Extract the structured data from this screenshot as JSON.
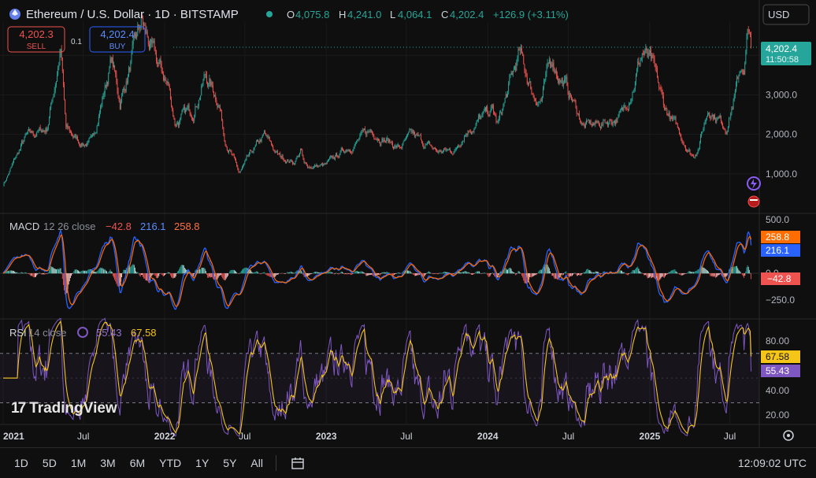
{
  "header": {
    "symbol": "Ethereum / U.S. Dollar · 1D · BITSTAMP",
    "open_label": "O",
    "open": "4,075.8",
    "high_label": "H",
    "high": "4,241.0",
    "low_label": "L",
    "low": "4,064.1",
    "close_label": "C",
    "close": "4,202.4",
    "change": "+126.9 (+3.11%)",
    "currency": "USD"
  },
  "trade": {
    "sell_price": "4,202.3",
    "sell_label": "SELL",
    "spread": "0.1",
    "buy_price": "4,202.4",
    "buy_label": "BUY"
  },
  "price_tag": {
    "price": "4,202.4",
    "countdown": "11:50:58"
  },
  "macd_legend": {
    "name": "MACD",
    "params": "12 26 close",
    "hist": "−42.8",
    "macd": "216.1",
    "signal": "258.8"
  },
  "rsi_legend": {
    "name": "RSI",
    "params": "14 close",
    "rsi": "55.43",
    "ma": "67.58"
  },
  "logo": {
    "text": "TradingView"
  },
  "bottom_bar": {
    "ranges": [
      "1D",
      "5D",
      "1M",
      "3M",
      "6M",
      "YTD",
      "1Y",
      "5Y",
      "All"
    ],
    "time": "12:09:02 UTC"
  },
  "colors": {
    "up": "#26a69a",
    "down": "#ef5350",
    "macd_line": "#2962ff",
    "signal_line": "#ff6d00",
    "rsi_line": "#7e57c2",
    "rsi_ma": "#f5c518",
    "price_tag": "#26a69a"
  },
  "chart_data": [
    {
      "type": "candlestick",
      "title": "Ethereum / U.S. Dollar · 1D · BITSTAMP",
      "x_ticks": [
        "2021",
        "Jul",
        "2022",
        "Jul",
        "2023",
        "Jul",
        "2024",
        "Jul",
        "2025",
        "Jul"
      ],
      "y_ticks": [
        "1,000.0",
        "2,000.0",
        "3,000.0"
      ],
      "ylim": [
        0,
        4800
      ],
      "price_path": [
        [
          "2021-01-01",
          730
        ],
        [
          "2021-02-20",
          1900
        ],
        [
          "2021-04-10",
          2150
        ],
        [
          "2021-05-11",
          4150
        ],
        [
          "2021-05-23",
          2100
        ],
        [
          "2021-06-25",
          1800
        ],
        [
          "2021-07-20",
          1780
        ],
        [
          "2021-09-03",
          3900
        ],
        [
          "2021-09-22",
          2800
        ],
        [
          "2021-11-10",
          4800
        ],
        [
          "2021-12-05",
          4000
        ],
        [
          "2022-01-10",
          3200
        ],
        [
          "2022-01-24",
          2300
        ],
        [
          "2022-03-05",
          2600
        ],
        [
          "2022-04-03",
          3500
        ],
        [
          "2022-05-05",
          2800
        ],
        [
          "2022-05-15",
          2000
        ],
        [
          "2022-06-18",
          1000
        ],
        [
          "2022-07-20",
          1550
        ],
        [
          "2022-08-14",
          1950
        ],
        [
          "2022-09-15",
          1450
        ],
        [
          "2022-10-20",
          1300
        ],
        [
          "2022-11-05",
          1600
        ],
        [
          "2022-11-12",
          1200
        ],
        [
          "2022-12-31",
          1200
        ],
        [
          "2023-02-15",
          1650
        ],
        [
          "2023-04-16",
          2100
        ],
        [
          "2023-06-15",
          1650
        ],
        [
          "2023-07-14",
          1950
        ],
        [
          "2023-09-11",
          1550
        ],
        [
          "2023-10-20",
          1600
        ],
        [
          "2023-11-10",
          2100
        ],
        [
          "2024-01-12",
          2600
        ],
        [
          "2024-01-23",
          2200
        ],
        [
          "2024-03-12",
          4000
        ],
        [
          "2024-04-13",
          3000
        ],
        [
          "2024-05-01",
          2900
        ],
        [
          "2024-05-25",
          3900
        ],
        [
          "2024-07-05",
          3000
        ],
        [
          "2024-08-05",
          2200
        ],
        [
          "2024-09-06",
          2250
        ],
        [
          "2024-11-01",
          2500
        ],
        [
          "2024-12-16",
          4100
        ],
        [
          "2025-01-06",
          3700
        ],
        [
          "2025-02-02",
          2700
        ],
        [
          "2025-03-10",
          2000
        ],
        [
          "2025-04-09",
          1450
        ],
        [
          "2025-04-22",
          1750
        ],
        [
          "2025-05-14",
          2700
        ],
        [
          "2025-06-22",
          2200
        ],
        [
          "2025-07-15",
          3100
        ],
        [
          "2025-07-28",
          3850
        ],
        [
          "2025-08-02",
          3500
        ],
        [
          "2025-08-13",
          4750
        ],
        [
          "2025-08-18",
          4202
        ]
      ]
    },
    {
      "type": "macd",
      "name": "MACD",
      "params": "12 26 close",
      "y_ticks": [
        "500.0",
        "0.0",
        "−250.0"
      ],
      "ylim": [
        -400,
        600
      ],
      "last": {
        "histogram": -42.8,
        "macd": 216.1,
        "signal": 258.8
      }
    },
    {
      "type": "rsi",
      "name": "RSI",
      "params": "14 close",
      "y_ticks": [
        "80.00",
        "40.00",
        "20.00"
      ],
      "bands": [
        70,
        30
      ],
      "ylim": [
        10,
        95
      ],
      "last": {
        "rsi": 55.43,
        "ma": 67.58
      }
    }
  ]
}
